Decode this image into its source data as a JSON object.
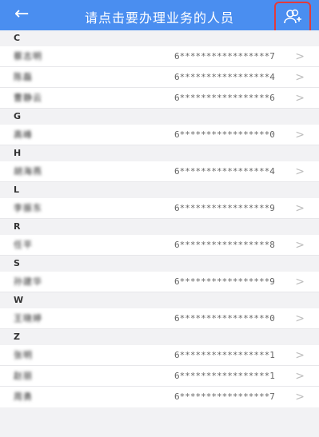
{
  "header": {
    "title": "请点击要办理业务的人员",
    "back_icon": "arrow-left-icon",
    "add_icon": "add-user-icon",
    "accent": "#4a8ef0",
    "highlight": "#e23b3b"
  },
  "groups": [
    {
      "letter": "C",
      "items": [
        {
          "name": "蔡志明",
          "account": "6*****************7"
        },
        {
          "name": "陈磊",
          "account": "6*****************4"
        },
        {
          "name": "曹静云",
          "account": "6*****************6"
        }
      ]
    },
    {
      "letter": "G",
      "items": [
        {
          "name": "高峰",
          "account": "6*****************0"
        }
      ]
    },
    {
      "letter": "H",
      "items": [
        {
          "name": "胡海燕",
          "account": "6*****************4"
        }
      ]
    },
    {
      "letter": "L",
      "items": [
        {
          "name": "李振东",
          "account": "6*****************9"
        }
      ]
    },
    {
      "letter": "R",
      "items": [
        {
          "name": "任平",
          "account": "6*****************8"
        }
      ]
    },
    {
      "letter": "S",
      "items": [
        {
          "name": "孙建华",
          "account": "6*****************9"
        }
      ]
    },
    {
      "letter": "W",
      "items": [
        {
          "name": "王晓婷",
          "account": "6*****************0"
        }
      ]
    },
    {
      "letter": "Z",
      "items": [
        {
          "name": "张明",
          "account": "6*****************1"
        },
        {
          "name": "赵丽",
          "account": "6*****************1"
        },
        {
          "name": "周勇",
          "account": "6*****************7"
        }
      ]
    }
  ]
}
